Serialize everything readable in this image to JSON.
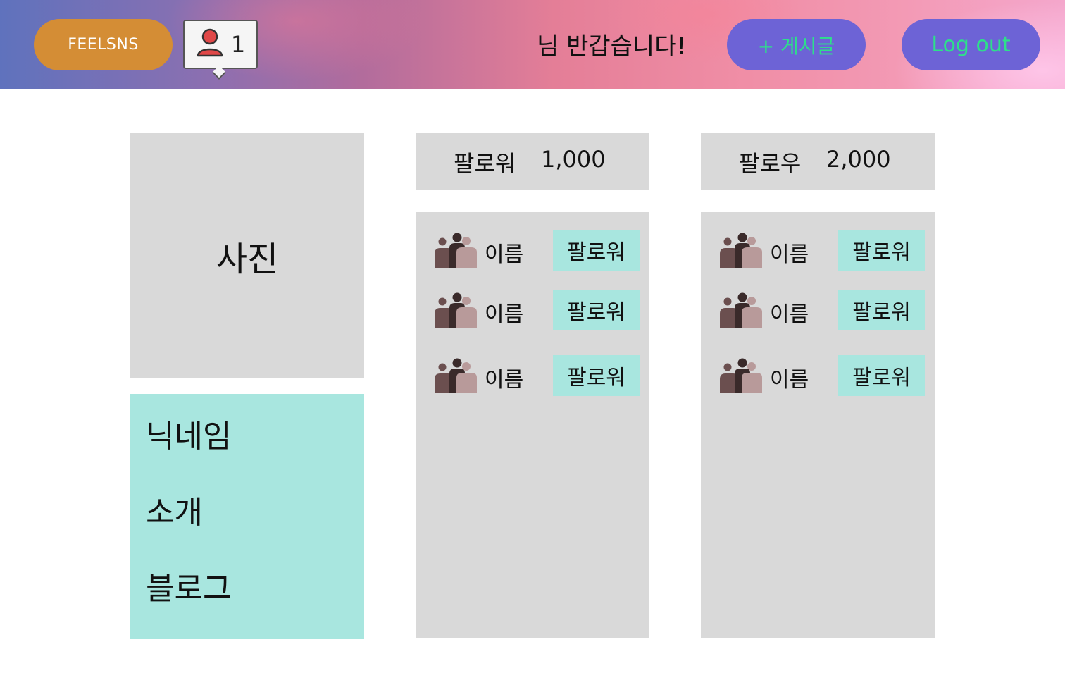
{
  "header": {
    "brand": "FEELSNS",
    "notification_icon": "user-icon",
    "notification_count": "1",
    "greeting": "님 반갑습니다!",
    "post_button": "+ 게시글",
    "logout_button": "Log out",
    "colors": {
      "brand": "#d48d35",
      "button": "#6d63d6",
      "button_text": "#2de08a",
      "icon": "#e04848"
    }
  },
  "profile": {
    "photo_label": "사진",
    "nickname": "닉네임",
    "intro": "소개",
    "blog": "블로그",
    "colors": {
      "photo_bg": "#d9d9d9",
      "info_bg": "#a8e6df"
    }
  },
  "followers": {
    "label": "팔로워",
    "count": "1,000",
    "items": [
      {
        "icon": "people-icon",
        "name": "이름",
        "button": "팔로워"
      },
      {
        "icon": "people-icon",
        "name": "이름",
        "button": "팔로워"
      },
      {
        "icon": "people-icon",
        "name": "이름",
        "button": "팔로워"
      }
    ]
  },
  "following": {
    "label": "팔로우",
    "count": "2,000",
    "items": [
      {
        "icon": "people-icon",
        "name": "이름",
        "button": "팔로워"
      },
      {
        "icon": "people-icon",
        "name": "이름",
        "button": "팔로워"
      },
      {
        "icon": "people-icon",
        "name": "이름",
        "button": "팔로워"
      }
    ]
  }
}
